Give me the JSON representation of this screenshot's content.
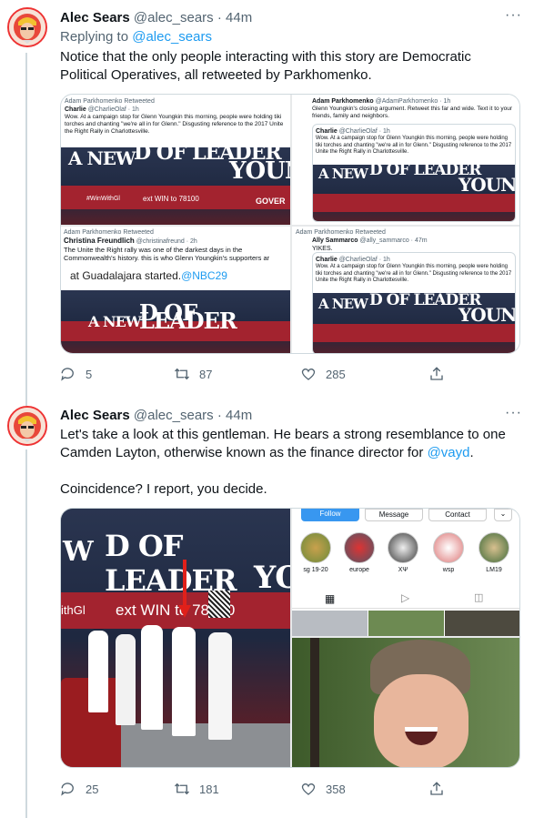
{
  "tweets": [
    {
      "author_name": "Alec Sears",
      "author_handle": "@alec_sears",
      "separator": "·",
      "time": "44m",
      "replying_prefix": "Replying to",
      "replying_handle": "@alec_sears",
      "text": "Notice that the only people interacting with this story are Democratic Political Operatives, all retweeted by Parkhomenko.",
      "media": {
        "left_top": {
          "retweet_line": "Adam Parkhomenko Retweeted",
          "name": "Charlie",
          "handle": "@CharlieOlaf · 1h",
          "text": "Wow. At a campaign stop for Glenn Youngkin this morning, people were holding tiki torches and chanting \"we're all in for Glenn.\" Disgusting reference to the 2017 Unite the Right Rally in Charlottesville."
        },
        "left_bottom": {
          "retweet_line": "Adam Parkhomenko Retweeted",
          "name": "Christina Freundlich",
          "handle": "@christinafreund · 2h",
          "text": "The Unite the Right rally was one of the darkest days in the Commonwealth's history. this is who Glenn Youngkin's supporters ar",
          "caption": "at Guadalajara started.",
          "caption_tag": "@NBC29"
        },
        "right_top": {
          "name": "Adam Parkhomenko",
          "handle": "@AdamParkhomenko · 1h",
          "text": "Glenn Youngkin's closing argument. Retweet this far and wide. Text it to your friends, family and neighbors.",
          "quote_name": "Charlie",
          "quote_handle": "@CharlieOlaf · 1h",
          "quote_text": "Wow. At a campaign stop for Glenn Youngkin this morning, people were holding tiki torches and chanting \"we're all in for Glenn.\" Disgusting reference to the 2017 Unite the Right Rally in Charlottesville."
        },
        "right_bottom": {
          "retweet_line": "Adam Parkhomenko Retweeted",
          "name": "Ally Sammarco",
          "handle": "@ally_sammarco · 47m",
          "text": "YIKES.",
          "quote_name": "Charlie",
          "quote_handle": "@CharlieOlaf · 1h",
          "quote_text": "Wow. At a campaign stop for Glenn Youngkin this morning, people were holding tiki torches and chanting \"we're all in for Glenn.\" Disgusting reference to the 2017 Unite the Right Rally in Charlottesville."
        },
        "bus_text_a": "A NEW",
        "bus_text_b": "D OF LEADER",
        "bus_text_c": "YOUNGK",
        "bus_text_d": "GOVER",
        "bus_hashtag": "#WinWithGl",
        "bus_text_e": "ext WIN to 78100"
      },
      "replies": "5",
      "retweets": "87",
      "likes": "285"
    },
    {
      "author_name": "Alec Sears",
      "author_handle": "@alec_sears",
      "separator": "·",
      "time": "44m",
      "text_line1": "Let's take a look at this gentleman. He bears a strong resemblance to one Camden Layton, otherwise known as the finance director for",
      "text_link": "@vayd",
      "text_end": ".",
      "text_line2": "Coincidence? I report, you decide.",
      "media": {
        "bus_text_a": "W",
        "bus_text_b": "D OF LEADER",
        "bus_text_c": "YO",
        "bus_text_d": "ithGl",
        "bus_text_e": "ext WIN to 78100",
        "profile_buttons": [
          "Follow",
          "Message",
          "Contact"
        ],
        "highlights": [
          "sg 19-20",
          "europe",
          "XΨ",
          "wsp",
          "LM19"
        ]
      },
      "replies": "25",
      "retweets": "181",
      "likes": "358"
    }
  ],
  "colors": {
    "link": "#1d9bf0",
    "secondary_text": "#536471",
    "thread_line": "#cfd9de",
    "bus_red": "#a3232f",
    "bus_navy": "#1e2840"
  },
  "icons": {
    "reply": "reply-icon",
    "retweet": "retweet-icon",
    "like": "heart-icon",
    "share": "share-icon",
    "more": "more-icon"
  }
}
